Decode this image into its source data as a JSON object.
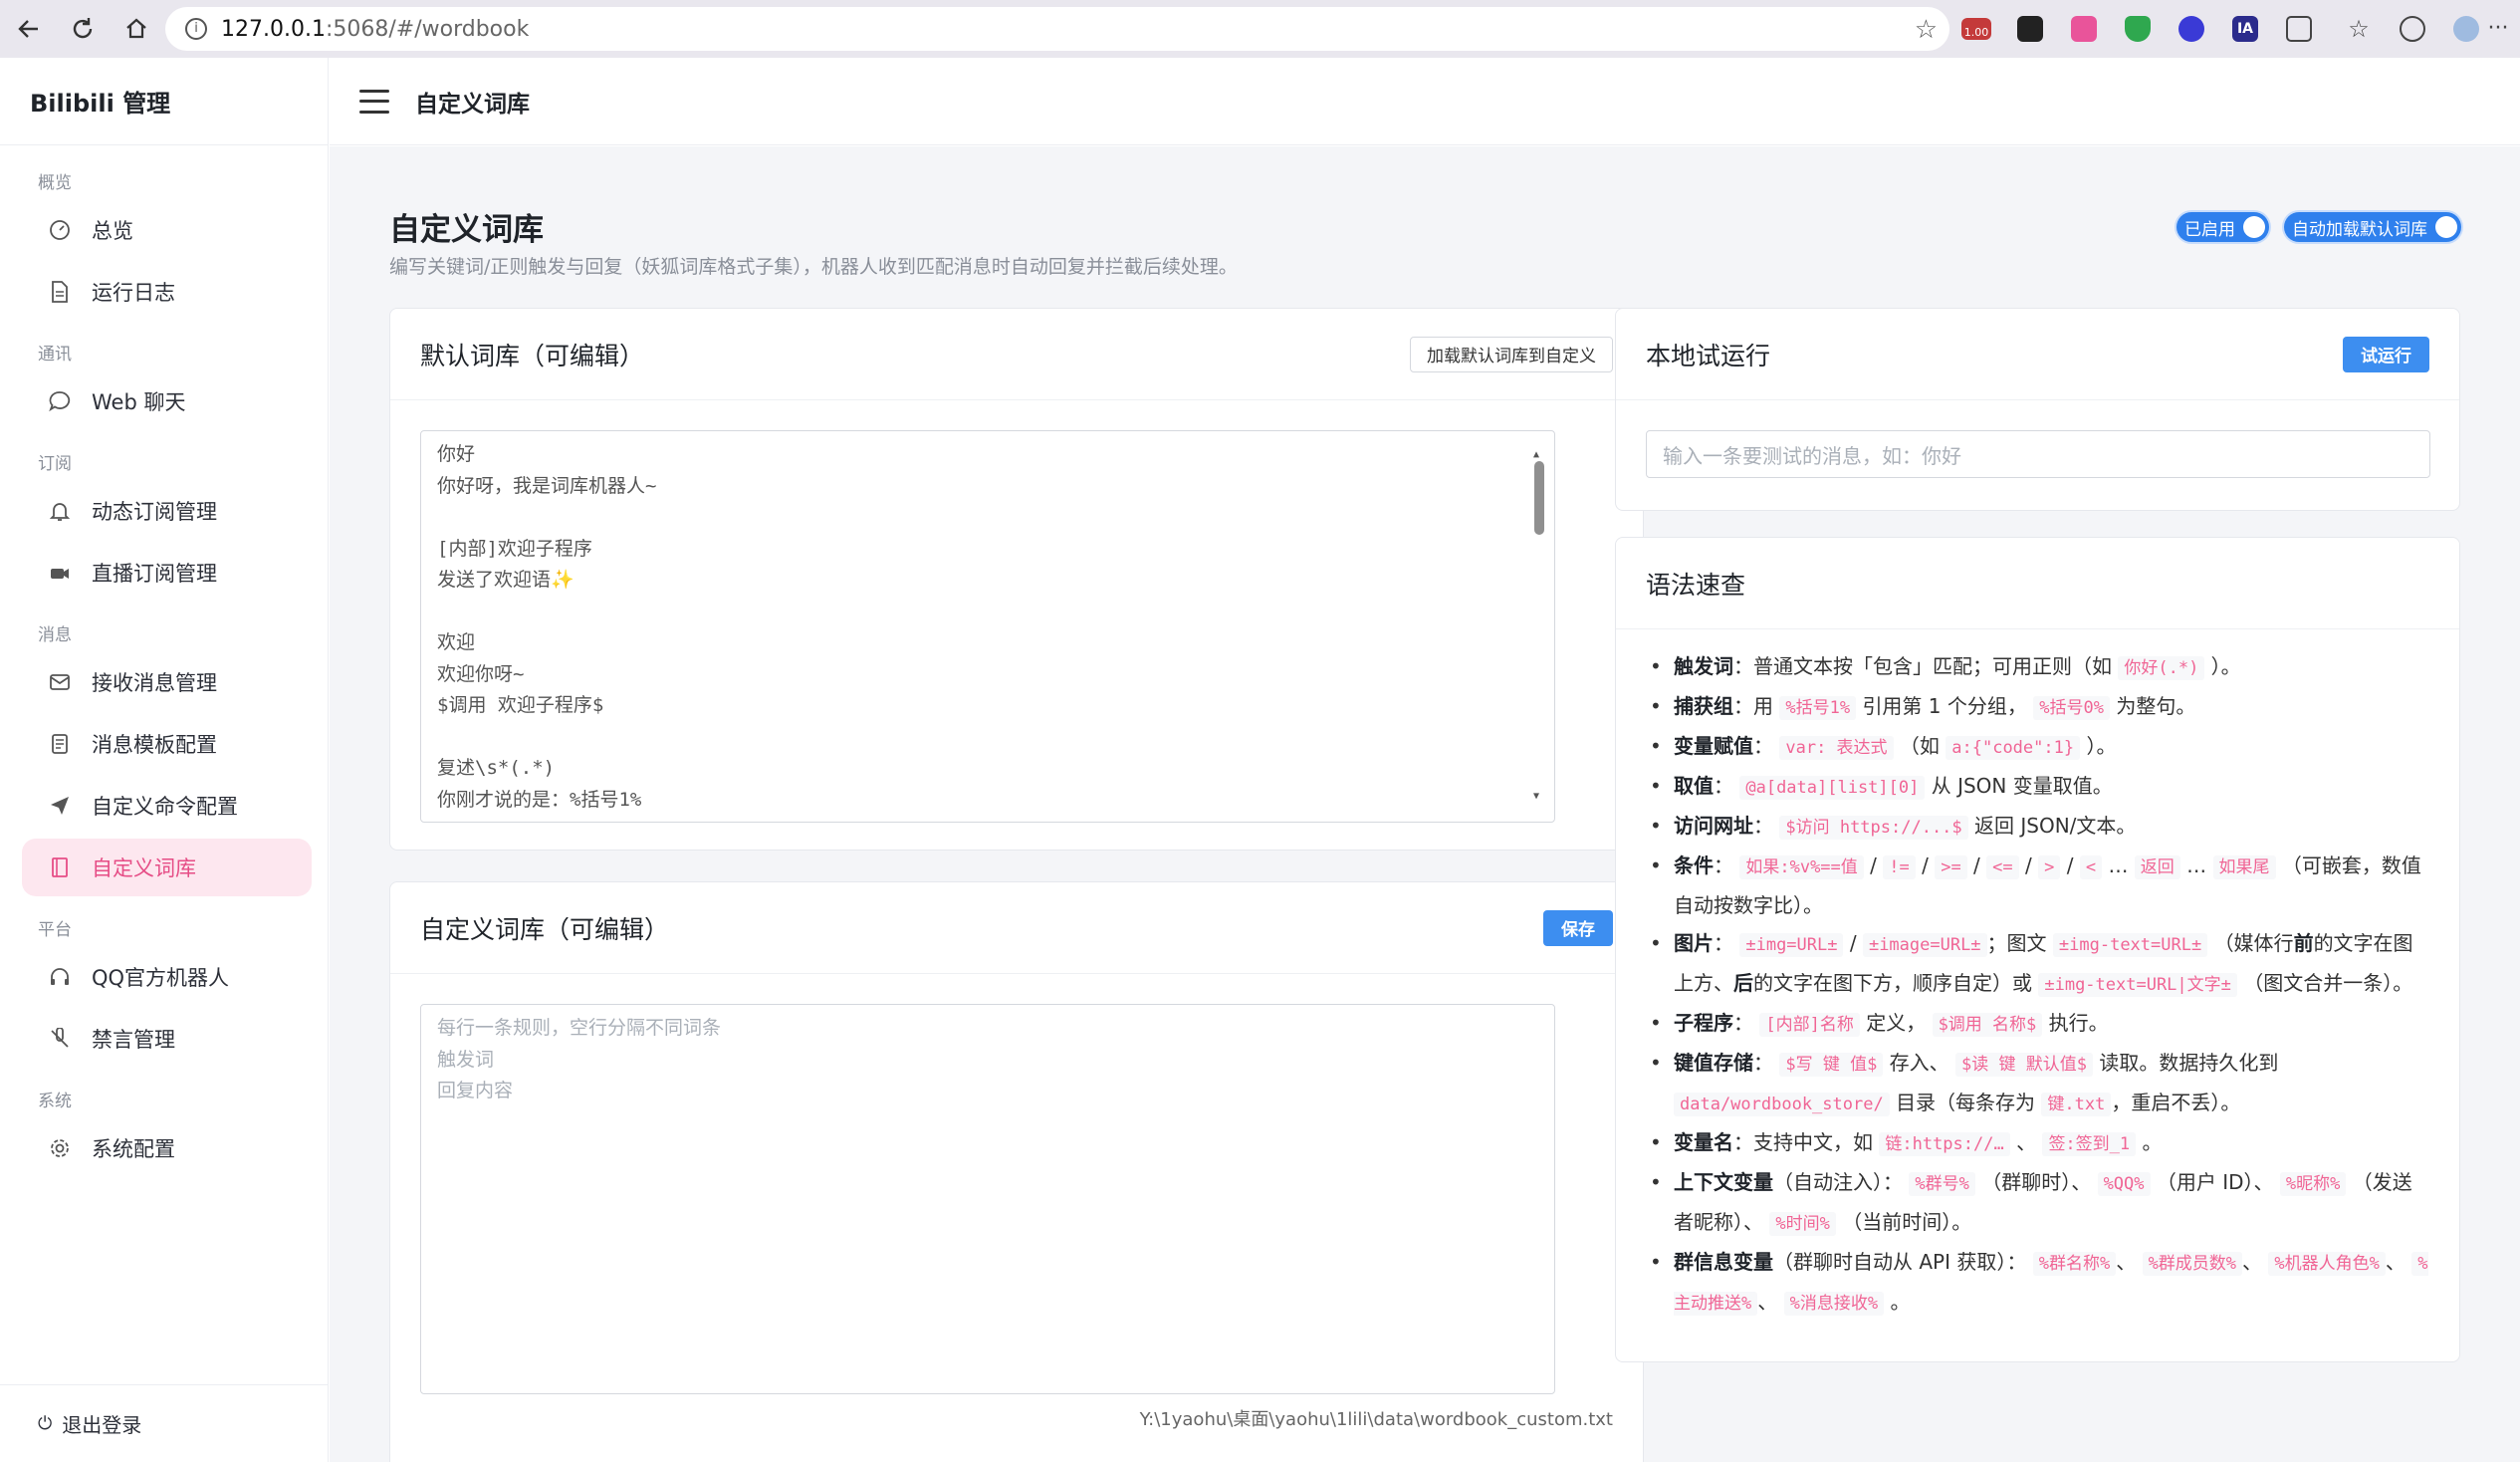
{
  "browser": {
    "url_host": "127.0.0.1",
    "url_path": ":5068/#/wordbook",
    "ext_badge": "1.00",
    "ext_label": "IA"
  },
  "sidebar": {
    "brand": "Bilibili 管理",
    "groups": [
      {
        "title": "概览",
        "items": [
          "总览",
          "运行日志"
        ]
      },
      {
        "title": "通讯",
        "items": [
          "Web 聊天"
        ]
      },
      {
        "title": "订阅",
        "items": [
          "动态订阅管理",
          "直播订阅管理"
        ]
      },
      {
        "title": "消息",
        "items": [
          "接收消息管理",
          "消息模板配置",
          "自定义命令配置",
          "自定义词库"
        ]
      },
      {
        "title": "平台",
        "items": [
          "QQ官方机器人",
          "禁言管理"
        ]
      },
      {
        "title": "系统",
        "items": [
          "系统配置"
        ]
      }
    ],
    "logout": "退出登录"
  },
  "topbar": {
    "title": "自定义词库"
  },
  "page": {
    "title": "自定义词库",
    "subtitle": "编写关键词/正则触发与回复（妖狐词库格式子集），机器人收到匹配消息时自动回复并拦截后续处理。",
    "toggle_enabled": "已启用",
    "toggle_autoload": "自动加载默认词库"
  },
  "default_card": {
    "title": "默认词库（可编辑）",
    "load_button": "加载默认词库到自定义",
    "lines": [
      "你好",
      "你好呀，我是词库机器人~",
      "",
      "[内部]欢迎子程序",
      "发送了欢迎语✨",
      "",
      "欢迎",
      "欢迎你呀~",
      "$调用 欢迎子程序$",
      "",
      "复述\\s*(.*)",
      "你刚才说的是：%括号1%"
    ]
  },
  "custom_card": {
    "title": "自定义词库（可编辑）",
    "save_button": "保存",
    "placeholder_lines": [
      "每行一条规则，空行分隔不同词条",
      "触发词",
      "回复内容"
    ],
    "file_path": "Y:\\1yaohu\\桌面\\yaohu\\1lili\\data\\wordbook_custom.txt"
  },
  "trial_card": {
    "title": "本地试运行",
    "run_button": "试运行",
    "input_placeholder": "输入一条要测试的消息，如：你好"
  },
  "syntax_card": {
    "title": "语法速查",
    "items": {
      "trigger_label": "触发词",
      "trigger_text_a": "：普通文本按「包含」匹配；可用正则（如",
      "trigger_code": "你好(.*)",
      "trigger_text_b": "）。",
      "capture_label": "捕获组",
      "capture_text_a": "：用",
      "capture_code1": "%括号1%",
      "capture_text_b": "引用第 1 个分组，",
      "capture_code2": "%括号0%",
      "capture_text_c": "为整句。",
      "assign_label": "变量赋值",
      "assign_text_a": "：",
      "assign_code1": "var: 表达式",
      "assign_text_b": "（如",
      "assign_code2": "a:{\"code\":1}",
      "assign_text_c": "）。",
      "get_label": "取值",
      "get_text_a": "：",
      "get_code": "@a[data][list][0]",
      "get_text_b": "从 JSON 变量取值。",
      "visit_label": "访问网址",
      "visit_text_a": "：",
      "visit_code": "$访问 https://...$",
      "visit_text_b": "返回 JSON/文本。",
      "cond_label": "条件",
      "cond_text_a": "：",
      "cond_code1": "如果:%v%==值",
      "cond_sep1": "/",
      "cond_code2": "!=",
      "cond_sep2": "/",
      "cond_code3": ">=",
      "cond_sep3": "/",
      "cond_code4": "<=",
      "cond_sep4": "/",
      "cond_code5": ">",
      "cond_sep5": "/",
      "cond_code6": "<",
      "cond_text_b": "…",
      "cond_code7": "返回",
      "cond_text_c": "…",
      "cond_code8": "如果尾",
      "cond_text_d": "（可嵌套，数值自动按数字比）。",
      "img_label": "图片",
      "img_text_a": "：",
      "img_code1": "±img=URL±",
      "img_sep": "/",
      "img_code2": "±image=URL±",
      "img_text_b": "；图文",
      "img_code3": "±img-text=URL±",
      "img_text_c": "（媒体行",
      "img_bold1": "前",
      "img_text_d": "的文字在图上方、",
      "img_bold2": "后",
      "img_text_e": "的文字在图下方，顺序自定）或",
      "img_code4": "±img-text=URL|文字±",
      "img_text_f": "（图文合并一条）。",
      "sub_label": "子程序",
      "sub_text_a": "：",
      "sub_code1": "[内部]名称",
      "sub_text_b": "定义，",
      "sub_code2": "$调用 名称$",
      "sub_text_c": "执行。",
      "kv_label": "键值存储",
      "kv_text_a": "：",
      "kv_code1": "$写 键 值$",
      "kv_text_b": "存入、",
      "kv_code2": "$读 键 默认值$",
      "kv_text_c": "读取。数据持久化到",
      "kv_code3": "data/wordbook_store/",
      "kv_text_d": "目录（每条存为",
      "kv_code4": "键.txt",
      "kv_text_e": "，重启不丢）。",
      "varname_label": "变量名",
      "varname_text_a": "：支持中文，如",
      "varname_code1": "链:https://…",
      "varname_text_b": "、",
      "varname_code2": "签:签到_1",
      "varname_text_c": "。",
      "ctx_label": "上下文变量",
      "ctx_text_a": "（自动注入）：",
      "ctx_code1": "%群号%",
      "ctx_text_b": "（群聊时）、",
      "ctx_code2": "%QQ%",
      "ctx_text_c": "（用户 ID）、",
      "ctx_code3": "%昵称%",
      "ctx_text_d": "（发送者昵称）、",
      "ctx_code4": "%时间%",
      "ctx_text_e": "（当前时间）。",
      "group_label": "群信息变量",
      "group_text_a": "（群聊时自动从 API 获取）：",
      "group_code1": "%群名称%",
      "group_sep1": "、",
      "group_code2": "%群成员数%",
      "group_sep2": "、",
      "group_code3": "%机器人角色%",
      "group_sep3": "、",
      "group_code4": "%主动推送%",
      "group_sep4": "、",
      "group_code5": "%消息接收%",
      "group_text_b": "。"
    }
  }
}
